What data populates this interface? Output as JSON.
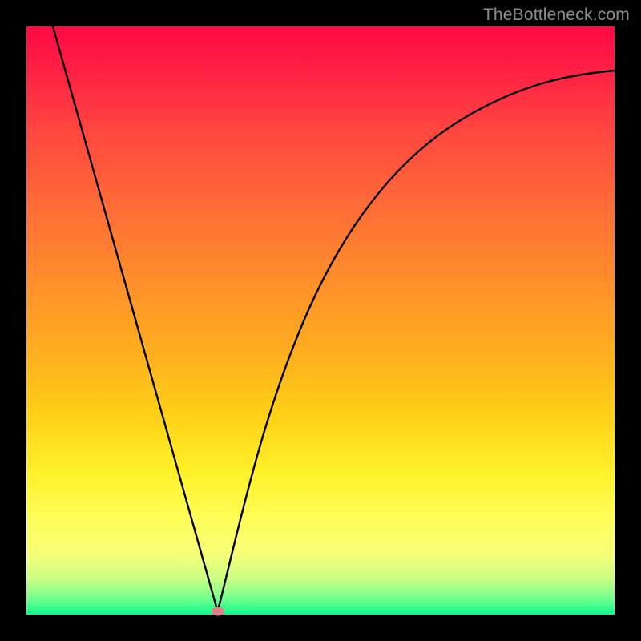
{
  "watermark": "TheBottleneck.com",
  "chart_data": {
    "type": "line",
    "title": "",
    "xlabel": "",
    "ylabel": "",
    "xlim": [
      0,
      100
    ],
    "ylim": [
      0,
      100
    ],
    "grid": false,
    "legend": false,
    "series": [
      {
        "name": "left-branch",
        "x": [
          4.5,
          8,
          12,
          16,
          20,
          24,
          28,
          30,
          31.5,
          32.5
        ],
        "y": [
          100,
          88,
          74,
          60,
          46,
          32,
          17,
          9,
          3,
          0.5
        ]
      },
      {
        "name": "right-branch",
        "x": [
          32.5,
          34,
          36,
          38,
          41,
          45,
          50,
          56,
          63,
          71,
          80,
          90,
          100
        ],
        "y": [
          0.5,
          4,
          12,
          20,
          30,
          41,
          52,
          61,
          69,
          76,
          82,
          87,
          91
        ]
      }
    ],
    "marker": {
      "x": 32.5,
      "y": 0.5,
      "color": "#e07f89"
    },
    "background_gradient": {
      "top": "#ff0845",
      "mid": "#ffd016",
      "bottom": "#08f787"
    },
    "curve_color": "#000000"
  }
}
